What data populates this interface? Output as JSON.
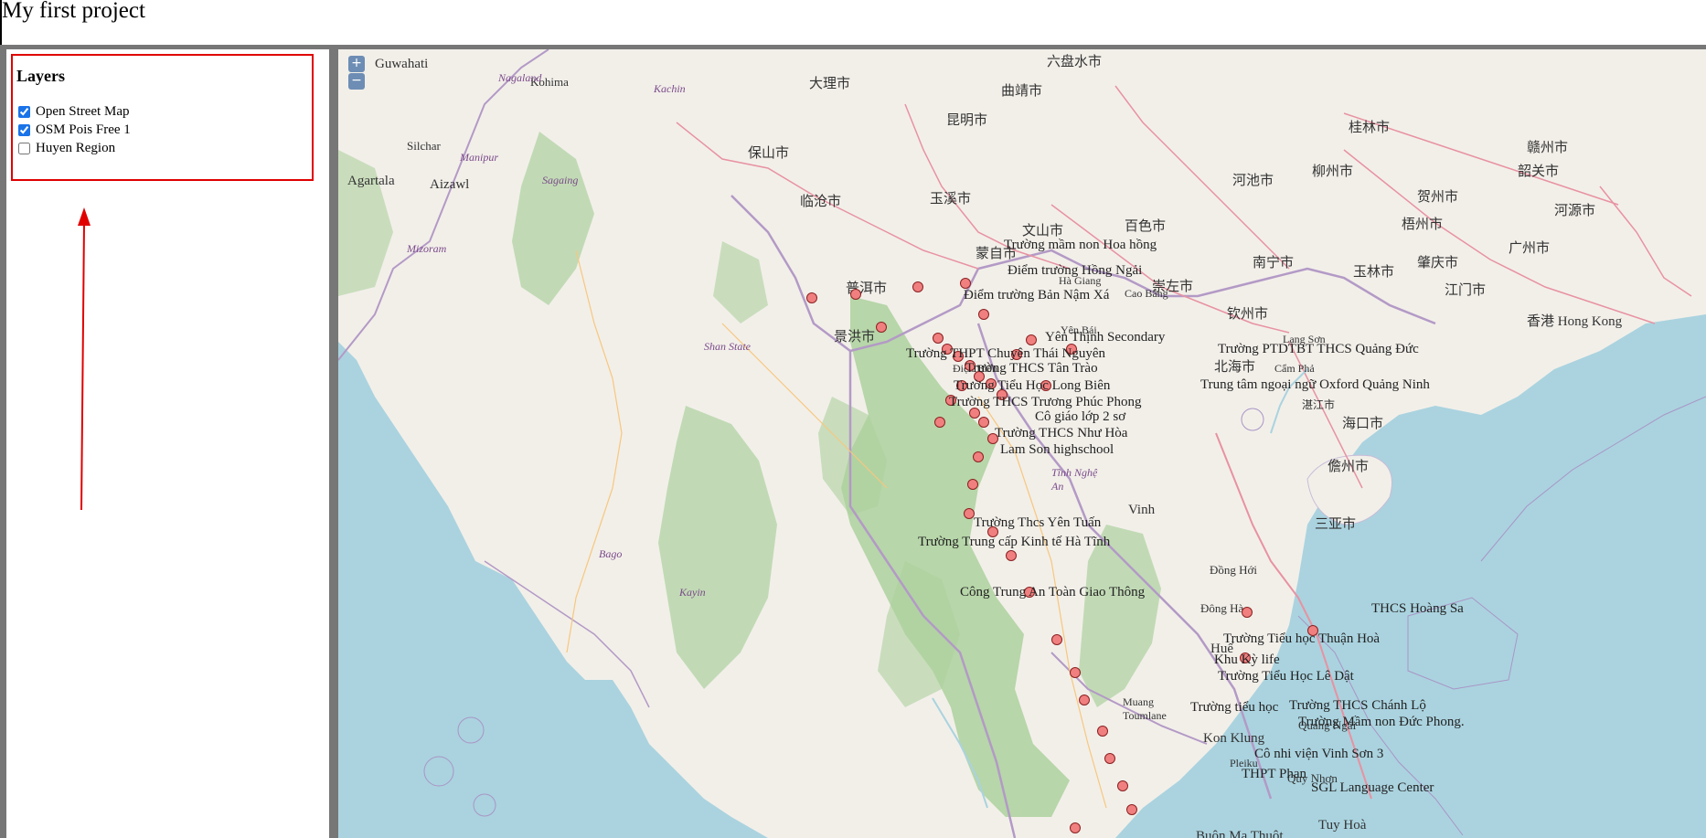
{
  "page": {
    "title": "My first project"
  },
  "layers_panel": {
    "title": "Layers",
    "items": [
      {
        "label": "Open Street Map",
        "checked": true
      },
      {
        "label": "OSM Pois Free 1",
        "checked": true
      },
      {
        "label": "Huyen Region",
        "checked": false
      }
    ]
  },
  "annotation": {
    "arrow_color": "#e00000"
  },
  "map": {
    "zoom_in": "+",
    "zoom_out": "−",
    "colors": {
      "sea": "#aad3df",
      "land": "#f2efe9",
      "forest": "#add19e",
      "poi_fill": "#f08080"
    },
    "cities": [
      "Guwahati",
      "Agartala",
      "Aizawl",
      "Kohima",
      "Silchar",
      "大理市",
      "昆明市",
      "曲靖市",
      "六盘水市",
      "保山市",
      "临沧市",
      "玉溪市",
      "蒙自市",
      "文山市",
      "普洱市",
      "景洪市",
      "南宁市",
      "玉林市",
      "肇庆市",
      "广州市",
      "江门市",
      "香港 Hong Kong",
      "柳州市",
      "桂林市",
      "河池市",
      "百色市",
      "钦州市",
      "北海市",
      "海口市",
      "儋州市",
      "三亚市",
      "湛江市",
      "梧州市",
      "贺州市",
      "河源市",
      "韶关市",
      "赣州市",
      "崇左市",
      "Lạng Sơn",
      "Cẩm Phả",
      "Vinh",
      "Đông Hà",
      "Huế",
      "Đồng Hới",
      "Quảng Ngãi",
      "Quy Nhơn",
      "Pleiku",
      "Kon Klung",
      "Tuy Hoà",
      "Buôn Ma Thuột",
      "Muang Toumlane",
      "Điện Biên",
      "Hà Giang",
      "Cao Bằng",
      "Yên Bái",
      "Tĩnh Nghệ An",
      "Shan State",
      "Sagaing",
      "Kachin",
      "Manipur",
      "Nagaland",
      "Mizoram",
      "Bago",
      "Kayin"
    ],
    "pois": [
      "Trường mầm non Hoa hồng",
      "Điểm trường Hồng Ngải",
      "Điểm trường Bản Nậm Xá",
      "Yên Thịnh Secondary",
      "Trường THPT Chuyên Thái Nguyên",
      "Trường THCS Tân Trào",
      "Trường Tiểu Học Long Biên",
      "Trường THCS Trương Phúc Phong",
      "Cô giáo lớp 2 sơ",
      "Trường THCS Như Hòa",
      "Lam Son highschool",
      "Trung tâm ngoại ngữ Oxford Quảng Ninh",
      "Trường PTDTBT THCS Quảng Đức",
      "Trường Thcs Yên Tuấn",
      "Trường Trung cấp Kinh tế Hà Tĩnh",
      "Công Trung An Toàn Giao Thông",
      "THCS Hoàng Sa",
      "Trường Tiểu học Thuận Hoà",
      "Khu Kỳ life",
      "Trường Tiểu Học Lê Dật",
      "Trường THCS Chánh Lộ",
      "Trường Mầm non Đức Phong.",
      "Trường tiểu học",
      "Cô nhi viện Vinh Sơn 3",
      "THPT Phan",
      "SGL Language Center"
    ]
  }
}
